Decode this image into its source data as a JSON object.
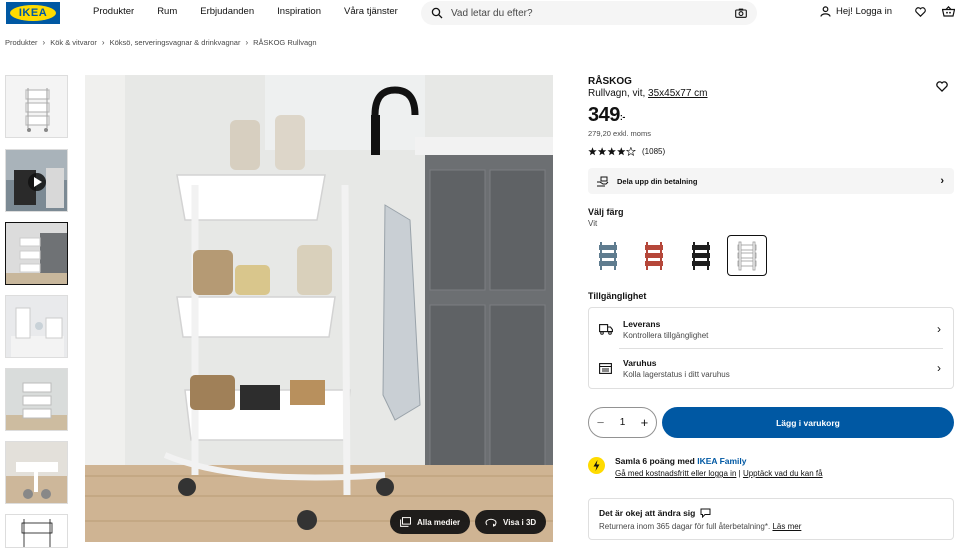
{
  "header": {
    "logo_text": "IKEA",
    "nav": [
      "Produkter",
      "Rum",
      "Erbjudanden",
      "Inspiration",
      "Våra tjänster"
    ],
    "search_placeholder": "Vad letar du efter?",
    "login_label": "Hej! Logga in"
  },
  "breadcrumb": [
    "Produkter",
    "Kök & vitvaror",
    "Köksö, serveringsvagnar & drinkvagnar",
    "RÅSKOG Rullvagn"
  ],
  "media": {
    "all_media_label": "Alla medier",
    "view_3d_label": "Visa i 3D"
  },
  "product": {
    "name": "RÅSKOG",
    "desc_prefix": "Rullvagn, vit,",
    "dimensions": "35x45x77 cm",
    "price": "349",
    "price_suffix": ":-",
    "price_ex_vat": "279,20 exkl. moms",
    "rating": 4.6,
    "review_count": "(1085)",
    "split_payment_label": "Dela upp din betalning"
  },
  "color": {
    "label": "Välj färg",
    "value": "Vit",
    "swatches": [
      {
        "name": "blue",
        "hex": "#5f7c8f"
      },
      {
        "name": "red",
        "hex": "#b5473a"
      },
      {
        "name": "black",
        "hex": "#1f1f1f"
      },
      {
        "name": "white",
        "hex": "#e7e7e4"
      }
    ],
    "selected_index": 3
  },
  "availability": {
    "title": "Tillgänglighet",
    "delivery_title": "Leverans",
    "delivery_sub": "Kontrollera tillgänglighet",
    "store_title": "Varuhus",
    "store_sub": "Kolla lagerstatus i ditt varuhus"
  },
  "cart": {
    "quantity": "1",
    "add_label": "Lägg i varukorg"
  },
  "family": {
    "text": "Samla 6 poäng med",
    "brand": "IKEA Family",
    "link1": "Gå med kostnadsfritt eller logga in",
    "sep": "|",
    "link2": "Upptäck vad du kan få"
  },
  "returns": {
    "title": "Det är okej att ändra sig",
    "text": "Returnera inom 365 dagar för full återbetalning*.",
    "link": "Läs mer"
  },
  "colors": {
    "ikea_blue": "#0058a3",
    "ikea_yellow": "#ffdb00"
  }
}
